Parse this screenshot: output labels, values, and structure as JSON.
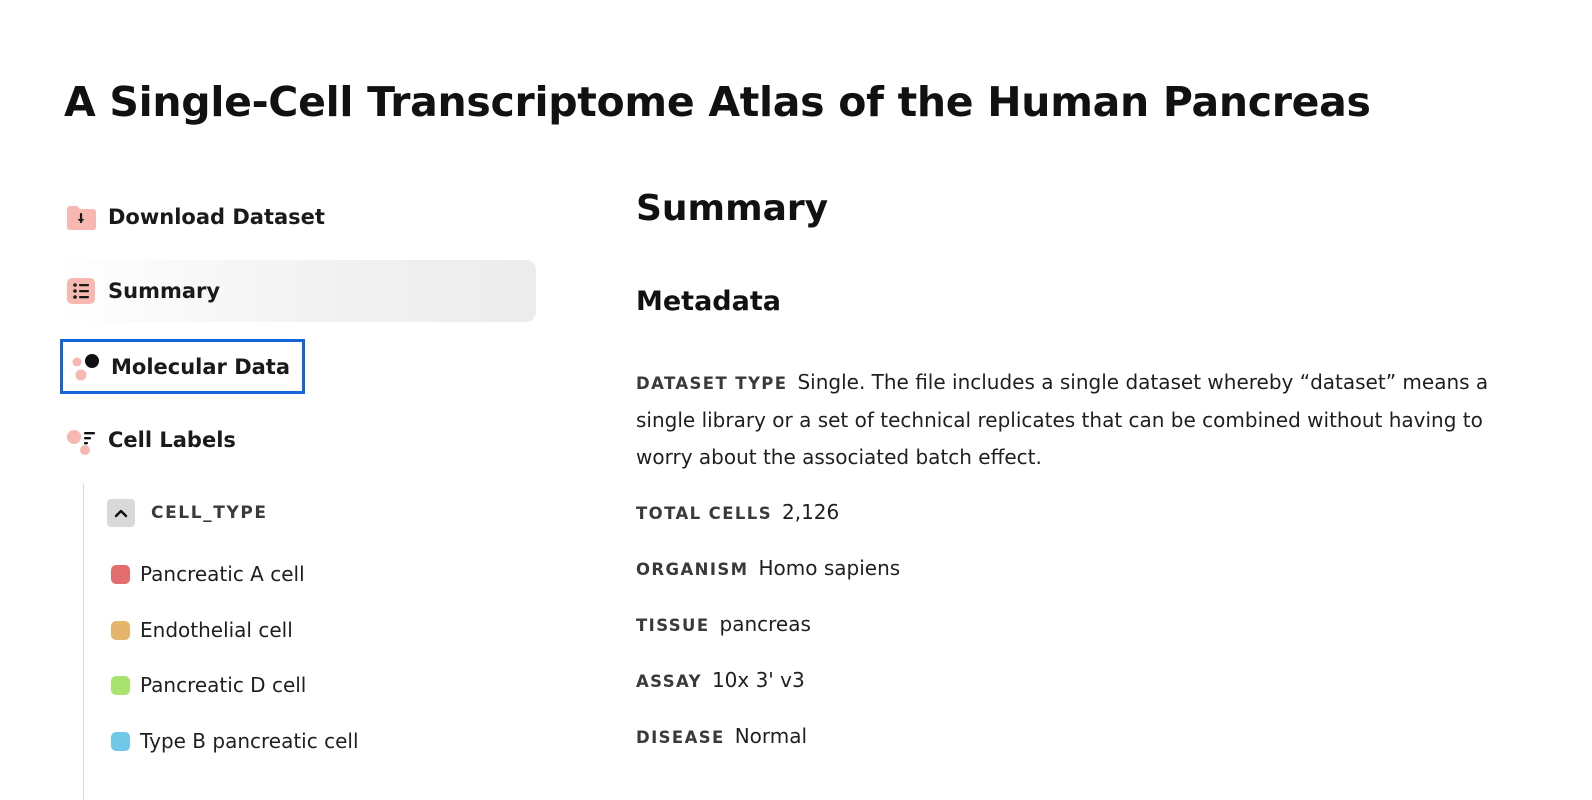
{
  "title": "A Single-Cell Transcriptome Atlas of the Human Pancreas",
  "sidebar": {
    "items": [
      {
        "label": "Download Dataset",
        "icon": "download-folder-icon"
      },
      {
        "label": "Summary",
        "icon": "list-icon",
        "active": true
      },
      {
        "label": "Molecular Data",
        "icon": "molecular-dots-icon",
        "focused": true
      },
      {
        "label": "Cell Labels",
        "icon": "cell-labels-icon"
      }
    ],
    "cell_type": {
      "label": "CELL_TYPE",
      "expanded": true,
      "legend": [
        {
          "label": "Pancreatic A cell",
          "color": "#e36d6d"
        },
        {
          "label": "Endothelial cell",
          "color": "#e5b56b"
        },
        {
          "label": "Pancreatic D cell",
          "color": "#a9e36f"
        },
        {
          "label": "Type B pancreatic cell",
          "color": "#6fc8e8"
        }
      ]
    }
  },
  "main": {
    "heading": "Summary",
    "subheading": "Metadata",
    "metadata": [
      {
        "key": "DATASET TYPE",
        "value": "Single. The file includes a single dataset whereby “dataset” means a single library or a set of technical replicates that can be combined without having to worry about the associated batch effect."
      },
      {
        "key": "TOTAL CELLS",
        "value": "2,126"
      },
      {
        "key": "ORGANISM",
        "value": "Homo sapiens"
      },
      {
        "key": "TISSUE",
        "value": "pancreas"
      },
      {
        "key": "ASSAY",
        "value": "10x 3' v3"
      },
      {
        "key": "DISEASE",
        "value": "Normal"
      }
    ]
  },
  "colors": {
    "icon_pink": "#f6b8b0",
    "focus_outline": "#1565d8",
    "active_bg": "#ececec"
  }
}
